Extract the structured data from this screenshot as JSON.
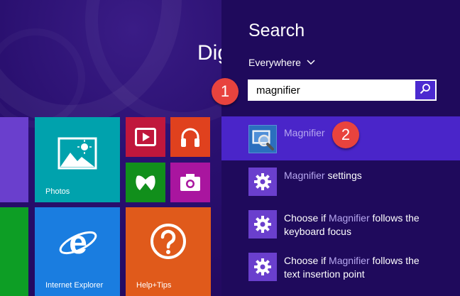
{
  "start_screen": {
    "user_name_partial": "Dig",
    "tiles": [
      {
        "id": "photos",
        "label": "Photos",
        "color": "#00a2ad",
        "icon": "photos-icon"
      },
      {
        "id": "video",
        "label": "",
        "color": "#c0173c",
        "icon": "video-icon"
      },
      {
        "id": "music",
        "label": "",
        "color": "#e0411e",
        "icon": "headphones-icon"
      },
      {
        "id": "xbox",
        "label": "",
        "color": "#118f1b",
        "icon": "xbox-icon"
      },
      {
        "id": "camera",
        "label": "",
        "color": "#a9159f",
        "icon": "camera-icon"
      },
      {
        "id": "ie",
        "label": "Internet Explorer",
        "color": "#1a7de0",
        "icon": "internet-explorer-icon"
      },
      {
        "id": "help",
        "label": "Help+Tips",
        "color": "#e05a1b",
        "icon": "help-icon"
      }
    ]
  },
  "search_pane": {
    "title": "Search",
    "scope_label": "Everywhere",
    "query": "magnifier",
    "search_button_icon": "search-icon",
    "highlight": "Magnifier",
    "results": [
      {
        "highlight": "Magnifier",
        "rest_line1": "",
        "line2": "",
        "icon": "magnifier-app-icon",
        "selected": true
      },
      {
        "prefix": "",
        "highlight": "Magnifier",
        "rest_line1": " settings",
        "line2": "",
        "icon": "gear-icon",
        "selected": false
      },
      {
        "prefix": "Choose if ",
        "highlight": "Magnifier",
        "rest_line1": " follows the",
        "line2": "keyboard focus",
        "icon": "gear-icon",
        "selected": false
      },
      {
        "prefix": "Choose if ",
        "highlight": "Magnifier",
        "rest_line1": " follows the",
        "line2": "text insertion point",
        "icon": "gear-icon",
        "selected": false
      }
    ]
  },
  "annotations": {
    "badge1": "1",
    "badge2": "2",
    "badge_color": "#e8433e"
  },
  "colors": {
    "pane_background": "#1f0a5c",
    "selected_result": "#4a25c9",
    "search_button": "#4b2ad0",
    "highlight_text": "#b7a8f0"
  }
}
